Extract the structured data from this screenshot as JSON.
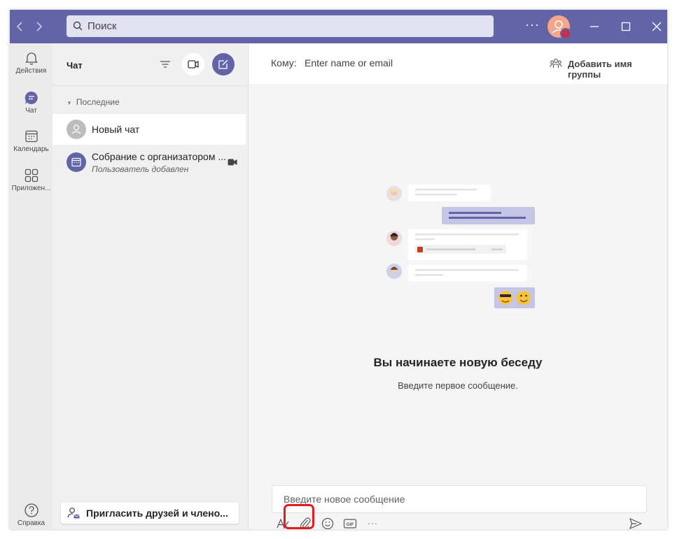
{
  "titlebar": {
    "search_placeholder": "Поиск",
    "more": "···"
  },
  "rail": [
    {
      "label": "Действия",
      "icon": "bell-icon"
    },
    {
      "label": "Чат",
      "icon": "chat-icon"
    },
    {
      "label": "Календарь",
      "icon": "calendar-icon"
    },
    {
      "label": "Приложен...",
      "icon": "apps-icon"
    }
  ],
  "rail_help": {
    "label": "Справка",
    "icon": "help-icon"
  },
  "chatlist": {
    "title": "Чат",
    "section": "Последние",
    "items": [
      {
        "name": "Новый чат",
        "subtitle": ""
      },
      {
        "name": "Собрание с организатором ...",
        "subtitle": "Пользователь добавлен"
      }
    ],
    "invite": "Пригласить друзей и члено..."
  },
  "main": {
    "to_label": "Кому:",
    "to_placeholder": "Enter name or email",
    "add_group": "Добавить имя группы",
    "conv_title": "Вы начинаете новую беседу",
    "conv_subtitle": "Введите первое сообщение.",
    "composer_placeholder": "Введите новое сообщение",
    "gif_label": "GIF"
  },
  "colors": {
    "brand": "#6264a7",
    "highlight": "#e21c1c"
  }
}
